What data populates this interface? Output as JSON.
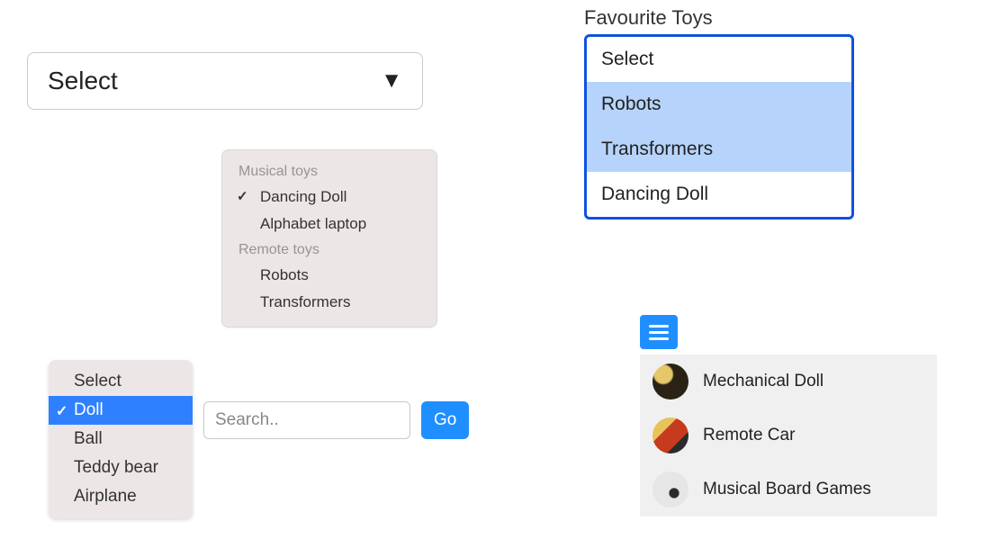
{
  "bigSelect": {
    "value": "Select"
  },
  "groupPopup": {
    "groups": [
      {
        "label": "Musical toys",
        "items": [
          {
            "label": "Dancing Doll",
            "checked": true
          },
          {
            "label": "Alphabet laptop",
            "checked": false
          }
        ]
      },
      {
        "label": "Remote toys",
        "items": [
          {
            "label": "Robots",
            "checked": false
          },
          {
            "label": "Transformers",
            "checked": false
          }
        ]
      }
    ]
  },
  "simplePopup": {
    "items": [
      {
        "label": "Select",
        "selected": false
      },
      {
        "label": "Doll",
        "selected": true
      },
      {
        "label": "Ball",
        "selected": false
      },
      {
        "label": "Teddy bear",
        "selected": false
      },
      {
        "label": "Airplane",
        "selected": false
      }
    ]
  },
  "search": {
    "placeholder": "Search..",
    "goLabel": "Go"
  },
  "favourites": {
    "heading": "Favourite Toys",
    "items": [
      {
        "label": "Select",
        "highlighted": false
      },
      {
        "label": "Robots",
        "highlighted": true
      },
      {
        "label": "Transformers",
        "highlighted": true
      },
      {
        "label": "Dancing Doll",
        "highlighted": false
      }
    ]
  },
  "iconList": {
    "items": [
      {
        "label": "Mechanical Doll"
      },
      {
        "label": "Remote Car"
      },
      {
        "label": "Musical Board Games"
      }
    ]
  }
}
